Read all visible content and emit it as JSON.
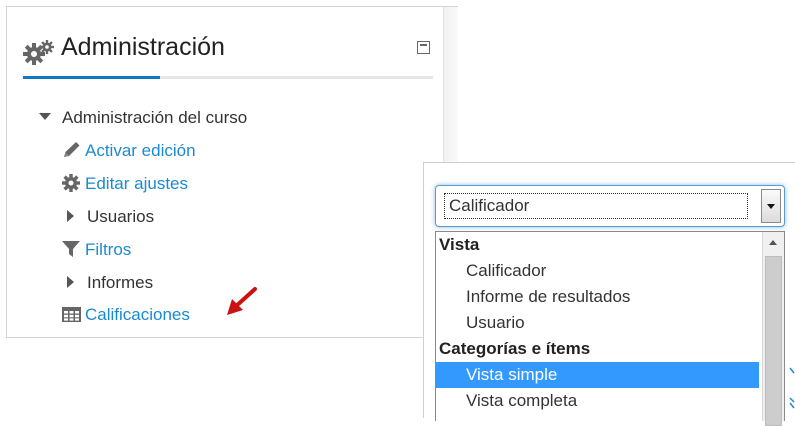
{
  "block": {
    "title": "Administración",
    "icon": "gears-icon",
    "collapse_icon": "minimize-icon"
  },
  "tree": {
    "root": "Administración del curso",
    "items": [
      {
        "label": "Activar edición",
        "icon": "pencil-icon",
        "type": "link"
      },
      {
        "label": "Editar ajustes",
        "icon": "gear-icon",
        "type": "link"
      },
      {
        "label": "Usuarios",
        "icon": "caret-right-icon",
        "type": "branch"
      },
      {
        "label": "Filtros",
        "icon": "filter-icon",
        "type": "link"
      },
      {
        "label": "Informes",
        "icon": "caret-right-icon",
        "type": "branch"
      },
      {
        "label": "Calificaciones",
        "icon": "table-icon",
        "type": "link"
      }
    ]
  },
  "annotation": {
    "icon": "red-arrow-icon",
    "color": "#cc1111"
  },
  "dropdown": {
    "selected": "Calificador",
    "options": [
      {
        "label": "Vista",
        "type": "group"
      },
      {
        "label": "Calificador",
        "type": "item"
      },
      {
        "label": "Informe de resultados",
        "type": "item"
      },
      {
        "label": "Usuario",
        "type": "item"
      },
      {
        "label": "Categorías e ítems",
        "type": "group"
      },
      {
        "label": "Vista simple",
        "type": "item",
        "highlighted": true
      },
      {
        "label": "Vista completa",
        "type": "item"
      }
    ]
  },
  "colors": {
    "link": "#1a8bd0",
    "accent": "#0f79c4",
    "highlight": "#3399ff",
    "focus_border": "#5b9bd5"
  }
}
